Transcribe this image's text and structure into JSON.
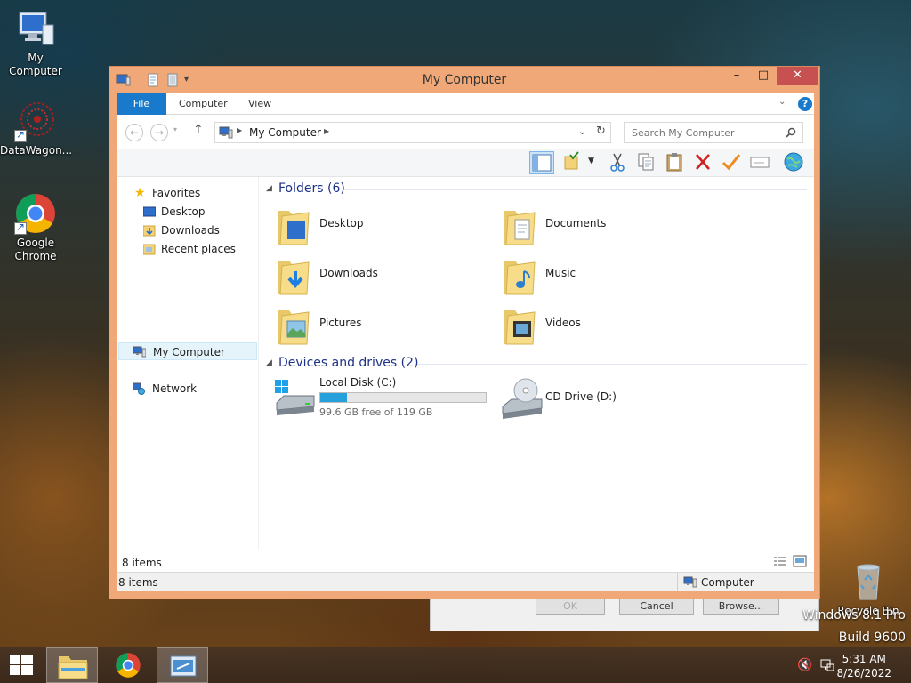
{
  "desktop": {
    "icons": [
      {
        "label": "My Computer"
      },
      {
        "label": "DataWagon..."
      },
      {
        "label": "Google Chrome"
      },
      {
        "label": "Recycle Bin"
      }
    ],
    "watermark_line1": "Windows 8.1 Pro",
    "watermark_line2": "Build 9600"
  },
  "bg_dialog": {
    "ok": "OK",
    "cancel": "Cancel",
    "browse": "Browse..."
  },
  "window": {
    "title": "My Computer",
    "controls": {
      "minimize": "–",
      "maximize": "□",
      "close": "✕"
    },
    "ribbon": {
      "tabs": [
        "File",
        "Computer",
        "View"
      ]
    },
    "address": {
      "path": "My Computer",
      "search_placeholder": "Search My Computer"
    },
    "nav": {
      "favorites": "Favorites",
      "desktop": "Desktop",
      "downloads": "Downloads",
      "recent": "Recent places",
      "my_computer": "My Computer",
      "network": "Network"
    },
    "folders_header": "Folders (6)",
    "folders": [
      "Desktop",
      "Documents",
      "Downloads",
      "Music",
      "Pictures",
      "Videos"
    ],
    "drives_header": "Devices and drives (2)",
    "drives": [
      {
        "name": "Local Disk (C:)",
        "free_text": "99.6 GB free of 119 GB",
        "used_fraction": 0.163
      },
      {
        "name": "CD Drive (D:)"
      }
    ],
    "status_items": "8 items",
    "status_bar_items": "8 items",
    "status_bar_location": "Computer"
  },
  "taskbar": {
    "time": "5:31 AM",
    "date": "8/26/2022"
  },
  "colors": {
    "accent": "#1979ca",
    "frame": "#f0a878",
    "close": "#c75050",
    "drive_fill": "#26a0da"
  }
}
